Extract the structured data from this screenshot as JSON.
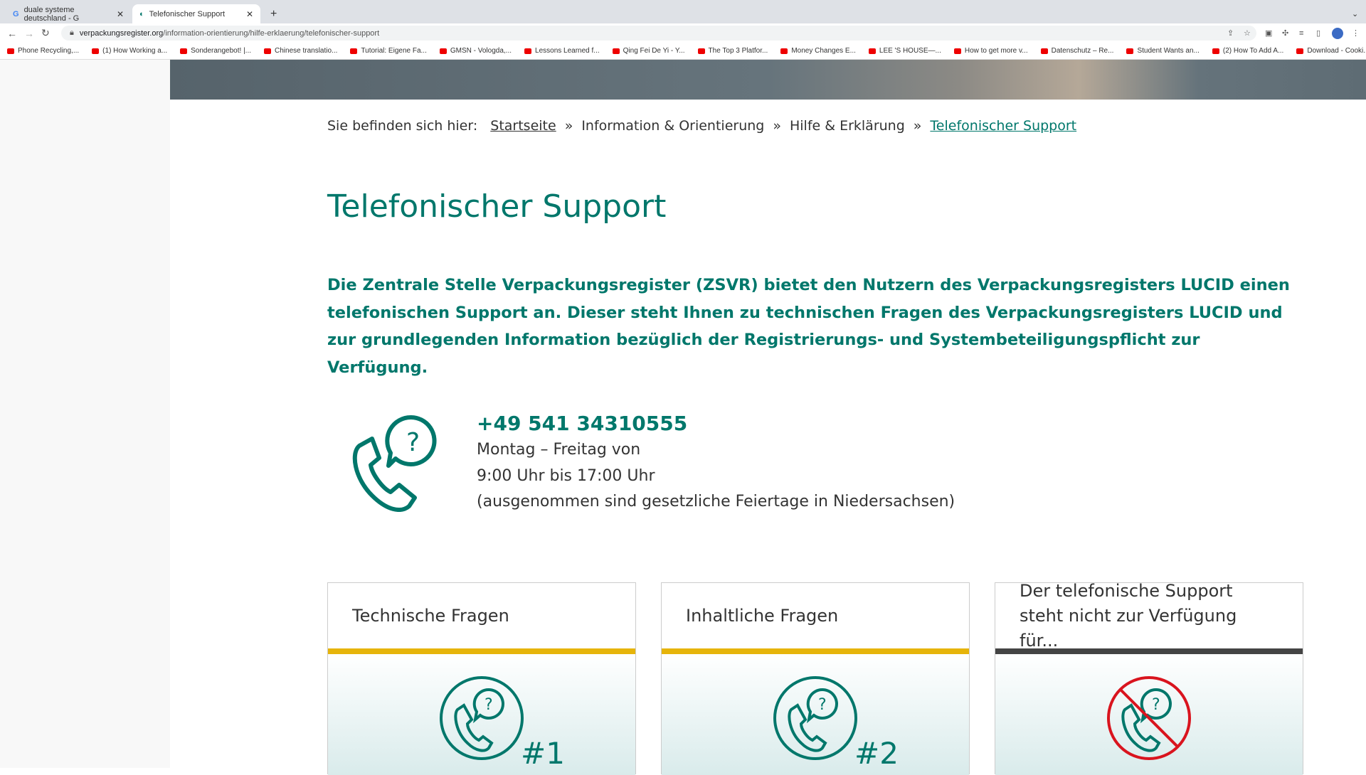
{
  "browser": {
    "tabs": [
      {
        "label": "duale systeme deutschland - G"
      },
      {
        "label": "Telefonischer Support"
      }
    ],
    "url_domain": "verpackungsregister.org",
    "url_path": "/information-orientierung/hilfe-erklaerung/telefonischer-support",
    "bookmarks": [
      "Phone Recycling,...",
      "(1) How Working a...",
      "Sonderangebot! |...",
      "Chinese translatio...",
      "Tutorial: Eigene Fa...",
      "GMSN - Vologda,...",
      "Lessons Learned f...",
      "Qing Fei De Yi - Y...",
      "The Top 3 Platfor...",
      "Money Changes E...",
      "LEE 'S HOUSE—...",
      "How to get more v...",
      "Datenschutz – Re...",
      "Student Wants an...",
      "(2) How To Add A...",
      "Download - Cooki..."
    ]
  },
  "breadcrumb": {
    "prefix": "Sie befinden sich hier:",
    "items": [
      "Startseite",
      "Information & Orientierung",
      "Hilfe & Erklärung",
      "Telefonischer Support"
    ],
    "sep": "»"
  },
  "page": {
    "title": "Telefonischer Support",
    "intro": "Die Zentrale Stelle Verpackungsregister (ZSVR) bietet den Nutzern des Verpackungsregisters LUCID einen telefonischen Support an. Dieser steht Ihnen zu technischen Fragen des Verpackungsregisters LUCID und zur grundlegenden Information bezüglich der Registrierungs- und Systembeteiligungspflicht zur Verfügung.",
    "phone": "+49 541 34310555",
    "hours1": "Montag – Freitag von",
    "hours2": "9:00 Uhr bis 17:00 Uhr",
    "hours3": "(ausgenommen sind gesetzliche Feiertage in Niedersachsen)"
  },
  "cards": [
    {
      "title": "Technische Fragen",
      "badge": "#1"
    },
    {
      "title": "Inhaltliche Fragen",
      "badge": "#2"
    },
    {
      "title": "Der telefonische Support steht nicht zur Verfügung für..."
    }
  ],
  "colors": {
    "teal": "#00776b",
    "yellow": "#e6b40a",
    "red": "#d9141e"
  }
}
